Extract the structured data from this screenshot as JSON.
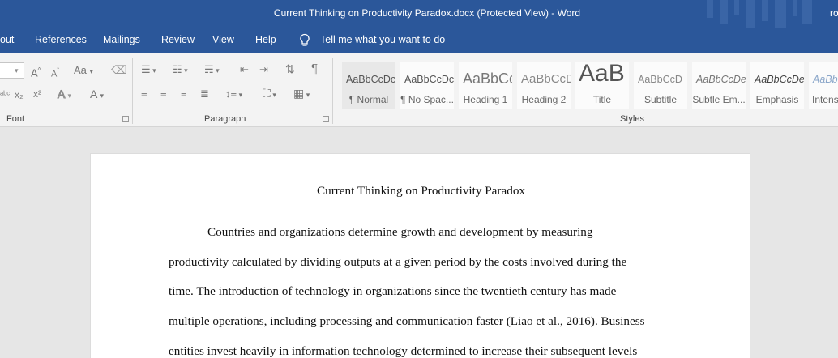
{
  "titlebar": {
    "title": "Current Thinking on Productivity Paradox.docx (Protected View)  -  Word",
    "user": "ro"
  },
  "tabs": [
    {
      "label": "out"
    },
    {
      "label": "References"
    },
    {
      "label": "Mailings"
    },
    {
      "label": "Review"
    },
    {
      "label": "View"
    },
    {
      "label": "Help"
    }
  ],
  "tell_me": {
    "label": "Tell me what you want to do",
    "icon": "lightbulb-icon"
  },
  "ribbon": {
    "groups": {
      "font": "Font",
      "paragraph": "Paragraph",
      "styles": "Styles"
    },
    "font_tools": {
      "change_case": "Aa",
      "font_color": "A",
      "text_effects": "A",
      "grow": "A",
      "shrink": "A"
    },
    "styles": [
      {
        "preview": "AaBbCcDc",
        "name": "¶ Normal"
      },
      {
        "preview": "AaBbCcDc",
        "name": "¶ No Spac..."
      },
      {
        "preview": "AaBbCc",
        "name": "Heading 1"
      },
      {
        "preview": "AaBbCcD",
        "name": "Heading 2"
      },
      {
        "preview": "AaB",
        "name": "Title"
      },
      {
        "preview": "AaBbCcD",
        "name": "Subtitle"
      },
      {
        "preview": "AaBbCcDe",
        "name": "Subtle Em..."
      },
      {
        "preview": "AaBbCcDe",
        "name": "Emphasis"
      },
      {
        "preview": "AaBbCcDe",
        "name": "Intens"
      }
    ]
  },
  "document": {
    "title": "Current Thinking on Productivity Paradox",
    "lines": [
      "Countries and organizations determine growth and development by measuring",
      "productivity calculated by dividing outputs at a given period by the costs involved during the",
      "time. The introduction of technology in organizations since the twentieth century has made",
      "multiple operations, including processing and communication faster (Liao et al., 2016). Business",
      "entities invest heavily in information technology determined to increase their subsequent levels"
    ]
  },
  "colors": {
    "accent": "#2b579a",
    "ribbon": "#f3f3f3",
    "canvas": "#e6e6e6"
  }
}
